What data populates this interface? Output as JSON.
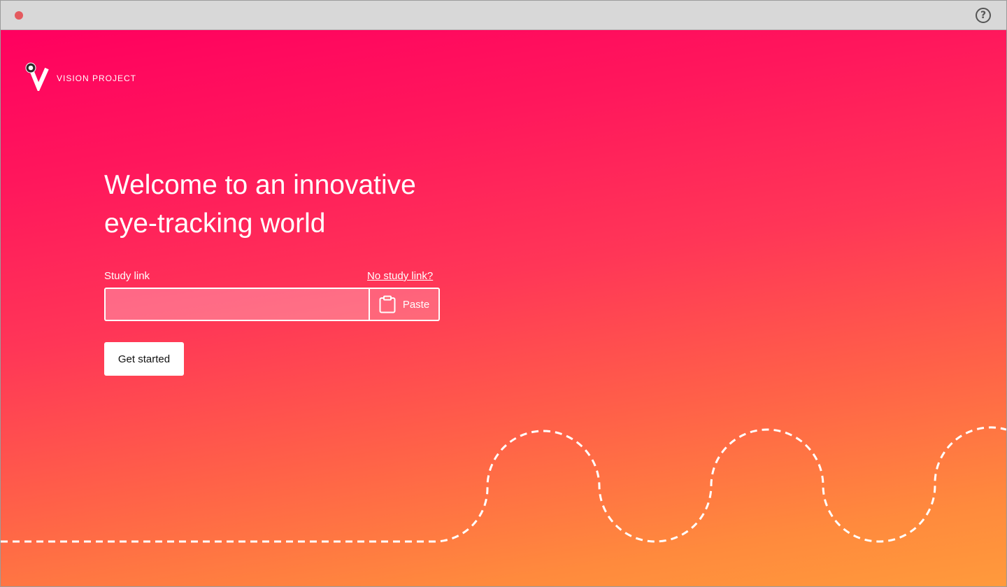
{
  "titlebar": {
    "close_dot_color": "#e45a5f",
    "help_icon": "?"
  },
  "brand": {
    "name": "VISION PROJECT",
    "logo_icon": "eye-v-logo-icon"
  },
  "hero": {
    "line1": "Welcome to an innovative",
    "line2": "eye-tracking world"
  },
  "form": {
    "study_link_label": "Study link",
    "no_link_text": "No study link?",
    "input_value": "",
    "paste_label": "Paste",
    "paste_icon": "clipboard-icon",
    "submit_label": "Get started"
  },
  "colors": {
    "gradient_top": "#ff005f",
    "gradient_bottom": "#ff9a3c",
    "text": "#ffffff"
  }
}
